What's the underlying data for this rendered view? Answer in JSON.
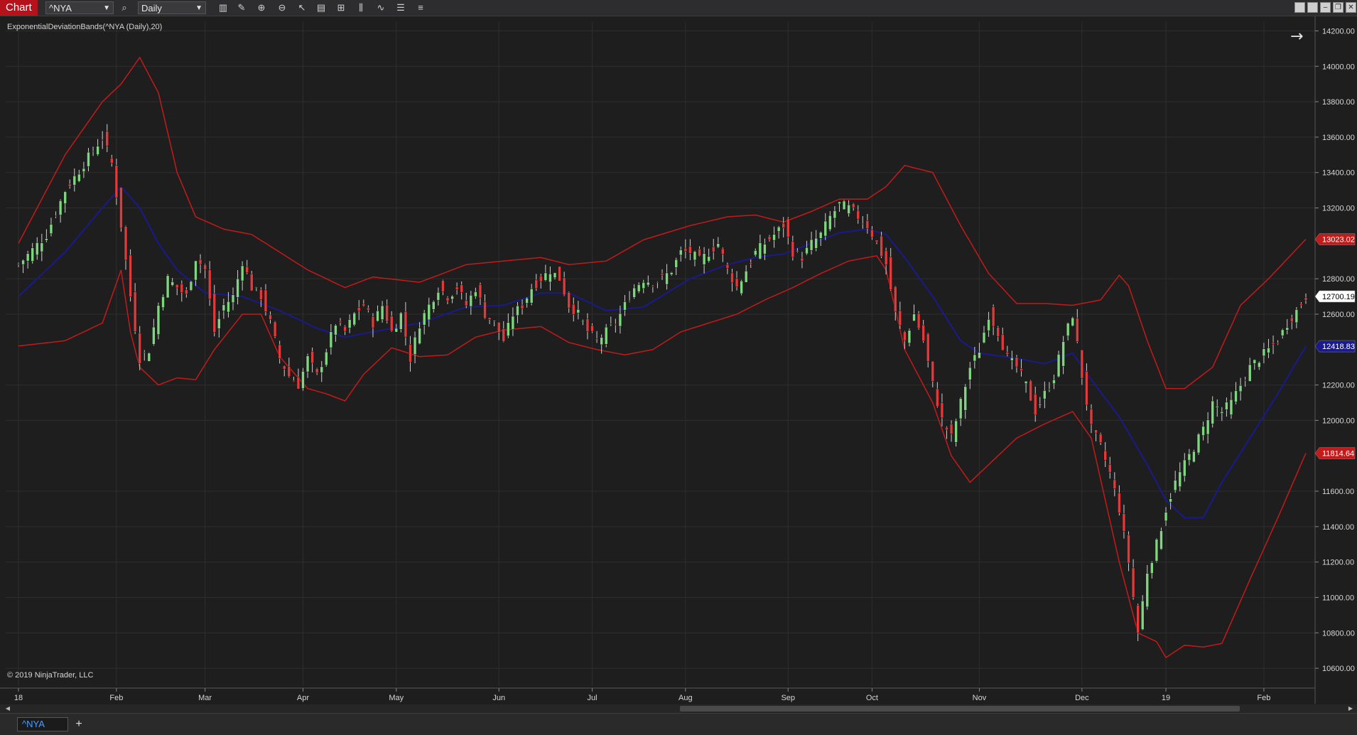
{
  "toolbar": {
    "chart_tab": "Chart",
    "instrument": "^NYA",
    "interval": "Daily",
    "icons": [
      "search-icon",
      "bar-type-icon",
      "draw-pencil-icon",
      "zoom-in-icon",
      "zoom-out-icon",
      "cursor-icon",
      "data-box-icon",
      "templates-icon",
      "indicators-icon",
      "strategies-icon",
      "properties-icon",
      "list-icon"
    ]
  },
  "colors": {
    "background": "#1e1e1e",
    "grid": "#2e2e2e",
    "up_candle": "#7ed67e",
    "down_candle": "#e23a3a",
    "bands": "#c41a1a",
    "midline": "#1a1a8c",
    "text": "#d6d6d6"
  },
  "chart_data": {
    "type": "candlestick",
    "indicator_label": "ExponentialDeviationBands(^NYA (Daily),20)",
    "copyright": "© 2019 NinjaTrader, LLC",
    "x_tick_labels": [
      "18",
      "Feb",
      "Mar",
      "Apr",
      "May",
      "Jun",
      "Jul",
      "Aug",
      "Sep",
      "Oct",
      "Nov",
      "Dec",
      "19",
      "Feb"
    ],
    "y_tick_labels": [
      "14200.00",
      "14000.00",
      "13800.00",
      "13600.00",
      "13400.00",
      "13200.00",
      "12800.00",
      "12600.00",
      "12200.00",
      "12000.00",
      "11600.00",
      "11400.00",
      "11200.00",
      "11000.00",
      "10800.00",
      "10600.00"
    ],
    "ylim": [
      10500,
      14250
    ],
    "price_markers": [
      {
        "label": "13023.02",
        "value": 13023.02,
        "color": "#c41a1a",
        "text_color": "#ffffff"
      },
      {
        "label": "12700.19",
        "value": 12700.19,
        "color": "#ffffff",
        "text_color": "#000000"
      },
      {
        "label": "12418.83",
        "value": 12418.83,
        "color": "#1a1a8c",
        "text_color": "#ffffff"
      },
      {
        "label": "11814.64",
        "value": 11814.64,
        "color": "#c41a1a",
        "text_color": "#ffffff"
      }
    ],
    "month_starts": [
      {
        "label": "18",
        "index": 0
      },
      {
        "label": "Feb",
        "index": 21
      },
      {
        "label": "Mar",
        "index": 40
      },
      {
        "label": "Apr",
        "index": 61
      },
      {
        "label": "May",
        "index": 81
      },
      {
        "label": "Jun",
        "index": 103
      },
      {
        "label": "Jul",
        "index": 123
      },
      {
        "label": "Aug",
        "index": 143
      },
      {
        "label": "Sep",
        "index": 165
      },
      {
        "label": "Oct",
        "index": 183
      },
      {
        "label": "Nov",
        "index": 206
      },
      {
        "label": "Dec",
        "index": 228
      },
      {
        "label": "19",
        "index": 246
      },
      {
        "label": "Feb",
        "index": 267
      }
    ],
    "close_anchors": [
      {
        "i": 0,
        "v": 12880
      },
      {
        "i": 6,
        "v": 13050
      },
      {
        "i": 10,
        "v": 13300
      },
      {
        "i": 14,
        "v": 13450
      },
      {
        "i": 18,
        "v": 13600
      },
      {
        "i": 20,
        "v": 13450
      },
      {
        "i": 22,
        "v": 13100
      },
      {
        "i": 24,
        "v": 12700
      },
      {
        "i": 26,
        "v": 12350
      },
      {
        "i": 28,
        "v": 12400
      },
      {
        "i": 30,
        "v": 12650
      },
      {
        "i": 32,
        "v": 12800
      },
      {
        "i": 34,
        "v": 12750
      },
      {
        "i": 36,
        "v": 12700
      },
      {
        "i": 38,
        "v": 12920
      },
      {
        "i": 40,
        "v": 12850
      },
      {
        "i": 42,
        "v": 12500
      },
      {
        "i": 44,
        "v": 12650
      },
      {
        "i": 46,
        "v": 12700
      },
      {
        "i": 48,
        "v": 12900
      },
      {
        "i": 50,
        "v": 12750
      },
      {
        "i": 52,
        "v": 12700
      },
      {
        "i": 54,
        "v": 12550
      },
      {
        "i": 56,
        "v": 12350
      },
      {
        "i": 58,
        "v": 12250
      },
      {
        "i": 60,
        "v": 12200
      },
      {
        "i": 62,
        "v": 12350
      },
      {
        "i": 64,
        "v": 12250
      },
      {
        "i": 66,
        "v": 12400
      },
      {
        "i": 68,
        "v": 12550
      },
      {
        "i": 70,
        "v": 12500
      },
      {
        "i": 72,
        "v": 12600
      },
      {
        "i": 74,
        "v": 12650
      },
      {
        "i": 76,
        "v": 12550
      },
      {
        "i": 78,
        "v": 12650
      },
      {
        "i": 80,
        "v": 12500
      },
      {
        "i": 82,
        "v": 12600
      },
      {
        "i": 84,
        "v": 12350
      },
      {
        "i": 86,
        "v": 12550
      },
      {
        "i": 88,
        "v": 12650
      },
      {
        "i": 90,
        "v": 12750
      },
      {
        "i": 92,
        "v": 12700
      },
      {
        "i": 94,
        "v": 12750
      },
      {
        "i": 96,
        "v": 12650
      },
      {
        "i": 98,
        "v": 12750
      },
      {
        "i": 100,
        "v": 12600
      },
      {
        "i": 102,
        "v": 12550
      },
      {
        "i": 104,
        "v": 12450
      },
      {
        "i": 106,
        "v": 12600
      },
      {
        "i": 108,
        "v": 12650
      },
      {
        "i": 110,
        "v": 12750
      },
      {
        "i": 112,
        "v": 12800
      },
      {
        "i": 114,
        "v": 12850
      },
      {
        "i": 116,
        "v": 12800
      },
      {
        "i": 118,
        "v": 12650
      },
      {
        "i": 120,
        "v": 12600
      },
      {
        "i": 122,
        "v": 12500
      },
      {
        "i": 124,
        "v": 12450
      },
      {
        "i": 126,
        "v": 12500
      },
      {
        "i": 128,
        "v": 12550
      },
      {
        "i": 130,
        "v": 12650
      },
      {
        "i": 132,
        "v": 12750
      },
      {
        "i": 134,
        "v": 12800
      },
      {
        "i": 136,
        "v": 12780
      },
      {
        "i": 138,
        "v": 12800
      },
      {
        "i": 140,
        "v": 12850
      },
      {
        "i": 142,
        "v": 12950
      },
      {
        "i": 144,
        "v": 12950
      },
      {
        "i": 146,
        "v": 12900
      },
      {
        "i": 148,
        "v": 12950
      },
      {
        "i": 150,
        "v": 13000
      },
      {
        "i": 152,
        "v": 12850
      },
      {
        "i": 154,
        "v": 12750
      },
      {
        "i": 156,
        "v": 12850
      },
      {
        "i": 158,
        "v": 12950
      },
      {
        "i": 160,
        "v": 13000
      },
      {
        "i": 162,
        "v": 13050
      },
      {
        "i": 164,
        "v": 13100
      },
      {
        "i": 166,
        "v": 12950
      },
      {
        "i": 168,
        "v": 12920
      },
      {
        "i": 170,
        "v": 13000
      },
      {
        "i": 172,
        "v": 13050
      },
      {
        "i": 174,
        "v": 13150
      },
      {
        "i": 176,
        "v": 13220
      },
      {
        "i": 178,
        "v": 13200
      },
      {
        "i": 180,
        "v": 13150
      },
      {
        "i": 182,
        "v": 13100
      },
      {
        "i": 184,
        "v": 13000
      },
      {
        "i": 186,
        "v": 12880
      },
      {
        "i": 188,
        "v": 12600
      },
      {
        "i": 190,
        "v": 12450
      },
      {
        "i": 192,
        "v": 12600
      },
      {
        "i": 194,
        "v": 12450
      },
      {
        "i": 196,
        "v": 12200
      },
      {
        "i": 198,
        "v": 12000
      },
      {
        "i": 200,
        "v": 11900
      },
      {
        "i": 202,
        "v": 12100
      },
      {
        "i": 204,
        "v": 12300
      },
      {
        "i": 206,
        "v": 12400
      },
      {
        "i": 208,
        "v": 12600
      },
      {
        "i": 210,
        "v": 12500
      },
      {
        "i": 212,
        "v": 12350
      },
      {
        "i": 214,
        "v": 12300
      },
      {
        "i": 216,
        "v": 12200
      },
      {
        "i": 218,
        "v": 12050
      },
      {
        "i": 220,
        "v": 12150
      },
      {
        "i": 222,
        "v": 12250
      },
      {
        "i": 224,
        "v": 12450
      },
      {
        "i": 226,
        "v": 12600
      },
      {
        "i": 228,
        "v": 12250
      },
      {
        "i": 230,
        "v": 11950
      },
      {
        "i": 232,
        "v": 11850
      },
      {
        "i": 234,
        "v": 11700
      },
      {
        "i": 236,
        "v": 11500
      },
      {
        "i": 238,
        "v": 11200
      },
      {
        "i": 240,
        "v": 10800
      },
      {
        "i": 242,
        "v": 11150
      },
      {
        "i": 244,
        "v": 11300
      },
      {
        "i": 246,
        "v": 11500
      },
      {
        "i": 248,
        "v": 11650
      },
      {
        "i": 250,
        "v": 11750
      },
      {
        "i": 252,
        "v": 11850
      },
      {
        "i": 254,
        "v": 11950
      },
      {
        "i": 256,
        "v": 12100
      },
      {
        "i": 258,
        "v": 12050
      },
      {
        "i": 260,
        "v": 12100
      },
      {
        "i": 262,
        "v": 12200
      },
      {
        "i": 264,
        "v": 12300
      },
      {
        "i": 266,
        "v": 12350
      },
      {
        "i": 268,
        "v": 12400
      },
      {
        "i": 270,
        "v": 12450
      },
      {
        "i": 272,
        "v": 12550
      },
      {
        "i": 274,
        "v": 12620
      },
      {
        "i": 276,
        "v": 12700
      }
    ],
    "bands": {
      "period": 20,
      "upper": [
        {
          "i": 0,
          "v": 13000
        },
        {
          "i": 10,
          "v": 13500
        },
        {
          "i": 18,
          "v": 13800
        },
        {
          "i": 22,
          "v": 13900
        },
        {
          "i": 26,
          "v": 14050
        },
        {
          "i": 30,
          "v": 13850
        },
        {
          "i": 34,
          "v": 13400
        },
        {
          "i": 38,
          "v": 13150
        },
        {
          "i": 44,
          "v": 13080
        },
        {
          "i": 50,
          "v": 13050
        },
        {
          "i": 56,
          "v": 12950
        },
        {
          "i": 62,
          "v": 12850
        },
        {
          "i": 70,
          "v": 12750
        },
        {
          "i": 76,
          "v": 12810
        },
        {
          "i": 86,
          "v": 12780
        },
        {
          "i": 96,
          "v": 12880
        },
        {
          "i": 104,
          "v": 12900
        },
        {
          "i": 112,
          "v": 12920
        },
        {
          "i": 118,
          "v": 12880
        },
        {
          "i": 126,
          "v": 12900
        },
        {
          "i": 134,
          "v": 13020
        },
        {
          "i": 144,
          "v": 13100
        },
        {
          "i": 152,
          "v": 13150
        },
        {
          "i": 158,
          "v": 13160
        },
        {
          "i": 164,
          "v": 13120
        },
        {
          "i": 170,
          "v": 13180
        },
        {
          "i": 176,
          "v": 13250
        },
        {
          "i": 182,
          "v": 13250
        },
        {
          "i": 186,
          "v": 13320
        },
        {
          "i": 190,
          "v": 13440
        },
        {
          "i": 196,
          "v": 13400
        },
        {
          "i": 202,
          "v": 13100
        },
        {
          "i": 208,
          "v": 12830
        },
        {
          "i": 214,
          "v": 12660
        },
        {
          "i": 220,
          "v": 12660
        },
        {
          "i": 226,
          "v": 12650
        },
        {
          "i": 232,
          "v": 12680
        },
        {
          "i": 236,
          "v": 12820
        },
        {
          "i": 238,
          "v": 12760
        },
        {
          "i": 242,
          "v": 12450
        },
        {
          "i": 246,
          "v": 12180
        },
        {
          "i": 250,
          "v": 12180
        },
        {
          "i": 256,
          "v": 12300
        },
        {
          "i": 262,
          "v": 12650
        },
        {
          "i": 268,
          "v": 12800
        },
        {
          "i": 276,
          "v": 13023
        }
      ],
      "middle": [
        {
          "i": 0,
          "v": 12700
        },
        {
          "i": 10,
          "v": 12950
        },
        {
          "i": 18,
          "v": 13200
        },
        {
          "i": 22,
          "v": 13320
        },
        {
          "i": 26,
          "v": 13200
        },
        {
          "i": 30,
          "v": 13000
        },
        {
          "i": 34,
          "v": 12850
        },
        {
          "i": 40,
          "v": 12720
        },
        {
          "i": 48,
          "v": 12700
        },
        {
          "i": 56,
          "v": 12620
        },
        {
          "i": 64,
          "v": 12520
        },
        {
          "i": 70,
          "v": 12470
        },
        {
          "i": 78,
          "v": 12510
        },
        {
          "i": 86,
          "v": 12550
        },
        {
          "i": 96,
          "v": 12640
        },
        {
          "i": 104,
          "v": 12650
        },
        {
          "i": 112,
          "v": 12720
        },
        {
          "i": 118,
          "v": 12720
        },
        {
          "i": 126,
          "v": 12620
        },
        {
          "i": 134,
          "v": 12640
        },
        {
          "i": 144,
          "v": 12800
        },
        {
          "i": 152,
          "v": 12880
        },
        {
          "i": 158,
          "v": 12920
        },
        {
          "i": 164,
          "v": 12940
        },
        {
          "i": 170,
          "v": 13000
        },
        {
          "i": 176,
          "v": 13060
        },
        {
          "i": 182,
          "v": 13080
        },
        {
          "i": 186,
          "v": 13050
        },
        {
          "i": 190,
          "v": 12920
        },
        {
          "i": 196,
          "v": 12700
        },
        {
          "i": 202,
          "v": 12450
        },
        {
          "i": 206,
          "v": 12380
        },
        {
          "i": 214,
          "v": 12350
        },
        {
          "i": 220,
          "v": 12320
        },
        {
          "i": 226,
          "v": 12380
        },
        {
          "i": 230,
          "v": 12230
        },
        {
          "i": 236,
          "v": 12020
        },
        {
          "i": 242,
          "v": 11750
        },
        {
          "i": 246,
          "v": 11550
        },
        {
          "i": 250,
          "v": 11450
        },
        {
          "i": 254,
          "v": 11450
        },
        {
          "i": 258,
          "v": 11650
        },
        {
          "i": 264,
          "v": 11900
        },
        {
          "i": 270,
          "v": 12150
        },
        {
          "i": 276,
          "v": 12419
        }
      ],
      "lower": [
        {
          "i": 0,
          "v": 12420
        },
        {
          "i": 10,
          "v": 12450
        },
        {
          "i": 18,
          "v": 12550
        },
        {
          "i": 22,
          "v": 12850
        },
        {
          "i": 24,
          "v": 12500
        },
        {
          "i": 26,
          "v": 12300
        },
        {
          "i": 30,
          "v": 12200
        },
        {
          "i": 34,
          "v": 12240
        },
        {
          "i": 38,
          "v": 12230
        },
        {
          "i": 42,
          "v": 12400
        },
        {
          "i": 48,
          "v": 12600
        },
        {
          "i": 52,
          "v": 12600
        },
        {
          "i": 56,
          "v": 12360
        },
        {
          "i": 62,
          "v": 12180
        },
        {
          "i": 66,
          "v": 12150
        },
        {
          "i": 70,
          "v": 12110
        },
        {
          "i": 74,
          "v": 12260
        },
        {
          "i": 80,
          "v": 12410
        },
        {
          "i": 86,
          "v": 12360
        },
        {
          "i": 92,
          "v": 12370
        },
        {
          "i": 98,
          "v": 12470
        },
        {
          "i": 104,
          "v": 12510
        },
        {
          "i": 112,
          "v": 12530
        },
        {
          "i": 118,
          "v": 12440
        },
        {
          "i": 124,
          "v": 12400
        },
        {
          "i": 130,
          "v": 12370
        },
        {
          "i": 136,
          "v": 12400
        },
        {
          "i": 142,
          "v": 12500
        },
        {
          "i": 148,
          "v": 12550
        },
        {
          "i": 154,
          "v": 12600
        },
        {
          "i": 160,
          "v": 12680
        },
        {
          "i": 166,
          "v": 12750
        },
        {
          "i": 172,
          "v": 12830
        },
        {
          "i": 178,
          "v": 12900
        },
        {
          "i": 184,
          "v": 12930
        },
        {
          "i": 186,
          "v": 12850
        },
        {
          "i": 190,
          "v": 12400
        },
        {
          "i": 196,
          "v": 12100
        },
        {
          "i": 200,
          "v": 11800
        },
        {
          "i": 204,
          "v": 11650
        },
        {
          "i": 210,
          "v": 11800
        },
        {
          "i": 214,
          "v": 11900
        },
        {
          "i": 220,
          "v": 11980
        },
        {
          "i": 226,
          "v": 12050
        },
        {
          "i": 230,
          "v": 11900
        },
        {
          "i": 236,
          "v": 11200
        },
        {
          "i": 240,
          "v": 10800
        },
        {
          "i": 244,
          "v": 10750
        },
        {
          "i": 246,
          "v": 10660
        },
        {
          "i": 250,
          "v": 10730
        },
        {
          "i": 254,
          "v": 10720
        },
        {
          "i": 258,
          "v": 10740
        },
        {
          "i": 264,
          "v": 11100
        },
        {
          "i": 270,
          "v": 11450
        },
        {
          "i": 276,
          "v": 11815
        }
      ]
    },
    "total_bars": 277,
    "grid": true
  },
  "bottom": {
    "symbol_tab": "^NYA",
    "add_tab": "+"
  }
}
